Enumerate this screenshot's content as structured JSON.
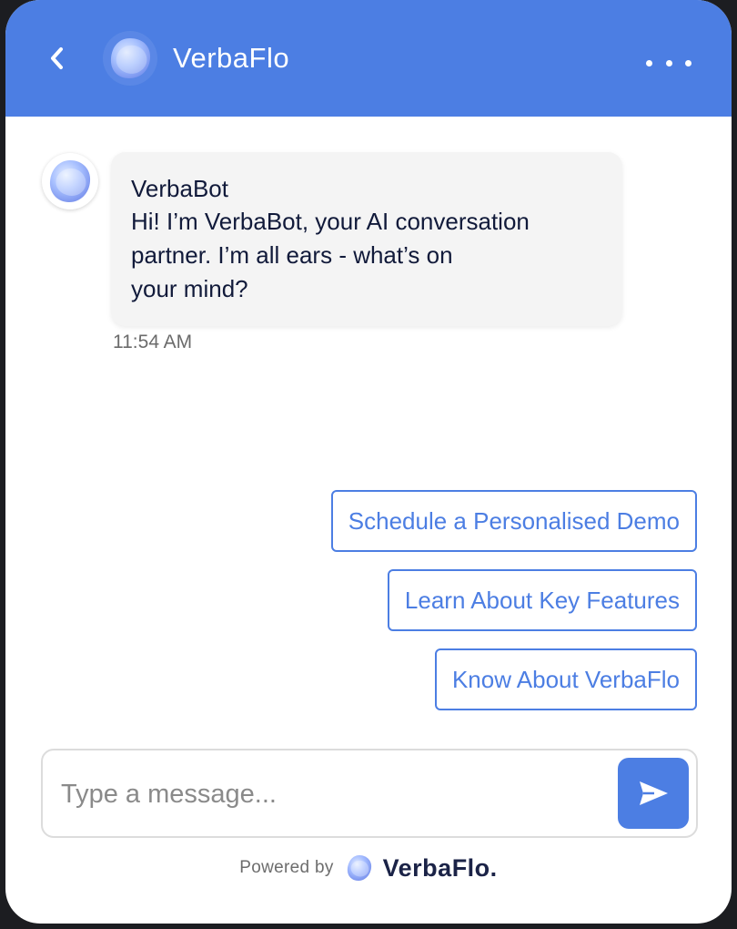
{
  "header": {
    "title": "VerbaFlo",
    "back_icon": "chevron-left-icon",
    "menu_icon": "more-horizontal-icon"
  },
  "message": {
    "sender": "VerbaBot",
    "text": "Hi! I’m VerbaBot, your AI conversation\npartner. I’m all ears - what’s on\nyour mind?",
    "time": "11:54 AM"
  },
  "quick_replies": [
    "Schedule a Personalised Demo",
    "Learn About Key Features",
    "Know About VerbaFlo"
  ],
  "composer": {
    "placeholder": "Type a message...",
    "value": "",
    "send_icon": "send-icon"
  },
  "footer": {
    "powered_by": "Powered by",
    "brand": "VerbaFlo."
  },
  "colors": {
    "accent": "#4c7ee3",
    "bubble_bg": "#f4f4f4",
    "text_dark": "#111a3a"
  }
}
